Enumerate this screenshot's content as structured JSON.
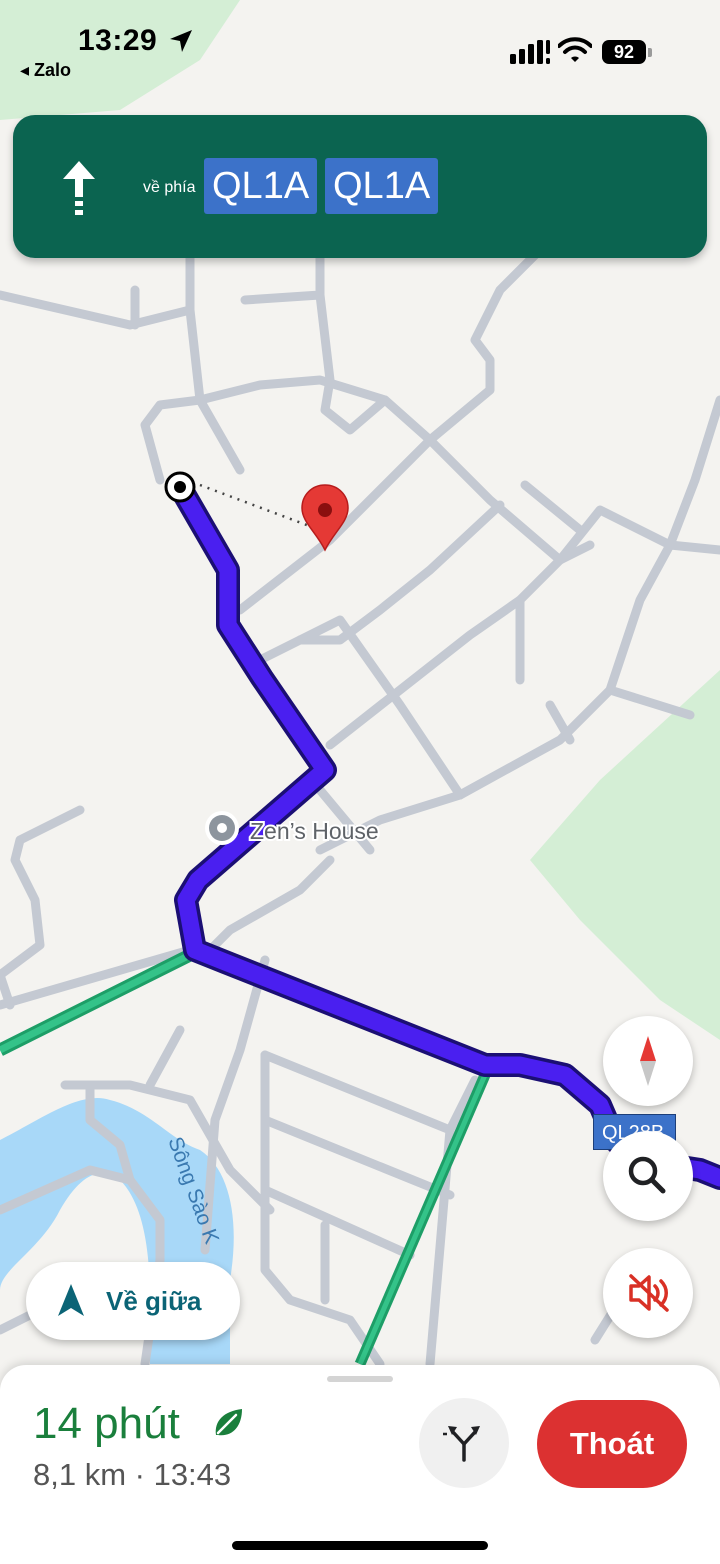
{
  "status_bar": {
    "time": "13:29",
    "back_app": "◂ Zalo",
    "battery": "92"
  },
  "nav_banner": {
    "toward_label": "về phía",
    "road_1": "QL1A",
    "road_2": "QL1A"
  },
  "map": {
    "place_label": "Zen’s House",
    "river_label": "Sông Sào K",
    "route_badge": "QL28B",
    "colors": {
      "route": "#4a1ff0",
      "highway": "#34c389",
      "water": "#a8d8f8",
      "park": "#d4eed5",
      "road": "#c4c9d2",
      "pin": "#e53935"
    }
  },
  "controls": {
    "recenter_label": "Về giữa",
    "compass": "compass-icon",
    "search": "search-icon",
    "mute": "volume-mute-icon"
  },
  "trip": {
    "eta_time": "14 phút",
    "distance_arrival": "8,1 km · 13:43",
    "exit_label": "Thoát"
  }
}
